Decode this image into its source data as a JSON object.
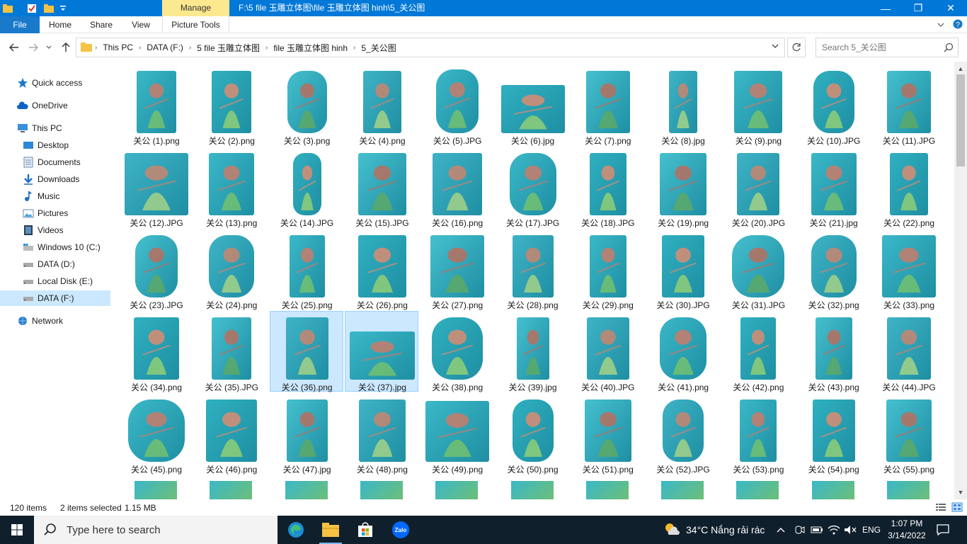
{
  "window": {
    "manage_label": "Manage",
    "title": "F:\\5 file 玉雕立体图\\file 玉雕立体图 hinh\\5_关公图",
    "minimize": "—",
    "maximize": "❐",
    "close": "✕"
  },
  "ribbon": {
    "tabs": [
      "File",
      "Home",
      "Share",
      "View",
      "Picture Tools"
    ]
  },
  "address": {
    "crumbs": [
      "This PC",
      "DATA (F:)",
      "5 file 玉雕立体图",
      "file 玉雕立体图 hinh",
      "5_关公图"
    ],
    "search_placeholder": "Search 5_关公图"
  },
  "nav": {
    "items": [
      {
        "label": "Quick access",
        "icon": "star-icon"
      },
      {
        "label": "OneDrive",
        "icon": "cloud-icon"
      },
      {
        "label": "This PC",
        "icon": "computer-icon"
      },
      {
        "label": "Desktop",
        "icon": "desktop-icon"
      },
      {
        "label": "Documents",
        "icon": "documents-icon"
      },
      {
        "label": "Downloads",
        "icon": "download-icon"
      },
      {
        "label": "Music",
        "icon": "music-icon"
      },
      {
        "label": "Pictures",
        "icon": "pictures-icon"
      },
      {
        "label": "Videos",
        "icon": "videos-icon"
      },
      {
        "label": "Windows 10 (C:)",
        "icon": "windows-drive-icon"
      },
      {
        "label": "DATA (D:)",
        "icon": "drive-icon"
      },
      {
        "label": "Local Disk (E:)",
        "icon": "drive-icon"
      },
      {
        "label": "DATA (F:)",
        "icon": "drive-icon"
      },
      {
        "label": "Network",
        "icon": "network-icon"
      }
    ]
  },
  "files": [
    "关公 (1).png",
    "关公 (2).png",
    "关公 (3).png",
    "关公 (4).png",
    "关公 (5).JPG",
    "关公 (6).jpg",
    "关公 (7).png",
    "关公 (8).jpg",
    "关公 (9).png",
    "关公 (10).JPG",
    "关公 (11).JPG",
    "关公 (12).JPG",
    "关公 (13).png",
    "关公 (14).JPG",
    "关公 (15).JPG",
    "关公 (16).png",
    "关公 (17).JPG",
    "关公 (18).JPG",
    "关公 (19).png",
    "关公 (20).JPG",
    "关公 (21).jpg",
    "关公 (22).png",
    "关公 (23).JPG",
    "关公 (24).png",
    "关公 (25).png",
    "关公 (26).png",
    "关公 (27).png",
    "关公 (28).png",
    "关公 (29).png",
    "关公 (30).JPG",
    "关公 (31).JPG",
    "关公 (32).png",
    "关公 (33).png",
    "关公 (34).png",
    "关公 (35).JPG",
    "关公 (36).png",
    "关公 (37).jpg",
    "关公 (38).png",
    "关公 (39).jpg",
    "关公 (40).JPG",
    "关公 (41).png",
    "关公 (42).png",
    "关公 (43).png",
    "关公 (44).JPG",
    "关公 (45).png",
    "关公 (46).png",
    "关公 (47).jpg",
    "关公 (48).png",
    "关公 (49).png",
    "关公 (50).png",
    "关公 (51).png",
    "关公 (52).JPG",
    "关公 (53).png",
    "关公 (54).png",
    "关公 (55).png"
  ],
  "selected_files": [
    "关公 (36).png",
    "关公 (37).jpg"
  ],
  "status": {
    "items": "120 items",
    "selected": "2 items selected",
    "size": "1.15 MB"
  },
  "taskbar": {
    "search_placeholder": "Type here to search",
    "weather": "34°C  Nắng rải rác",
    "language": "ENG",
    "time": "1:07 PM",
    "date": "3/14/2022",
    "apps": [
      "edge-icon",
      "file-explorer-icon",
      "store-icon",
      "zalo-icon"
    ],
    "zalo_label": "Zalo"
  },
  "colors": {
    "accent": "#0078d7",
    "manage_tab": "#fce98f",
    "selection": "#cce8ff",
    "taskbar": "#0f1f2c",
    "jade_teal": "#3ab8c8",
    "jade_green": "#6fbf73",
    "carving_rose": "#c97b6a"
  }
}
